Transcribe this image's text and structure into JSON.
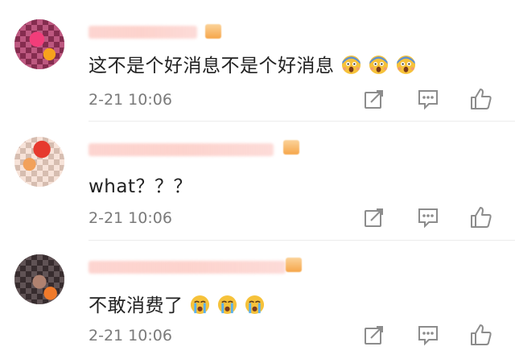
{
  "comments": [
    {
      "content": "这不是个好消息不是个好消息",
      "emoji": [
        "scream-emoji",
        "scream-emoji",
        "scream-emoji"
      ],
      "time": "2-21 10:06",
      "actions": [
        "share-icon",
        "comment-icon",
        "like-icon"
      ]
    },
    {
      "content": "what？？？",
      "emoji": [],
      "time": "2-21 10:06",
      "actions": [
        "share-icon",
        "comment-icon",
        "like-icon"
      ]
    },
    {
      "content": "不敢消费了",
      "emoji": [
        "crying-emoji",
        "crying-emoji",
        "crying-emoji"
      ],
      "time": "2-21 10:06",
      "actions": [
        "share-icon",
        "comment-icon",
        "like-icon"
      ]
    }
  ],
  "colors": {
    "text": "#222222",
    "meta": "#7a7a7a",
    "icon": "#8c8c8c",
    "divider": "#ececec"
  }
}
